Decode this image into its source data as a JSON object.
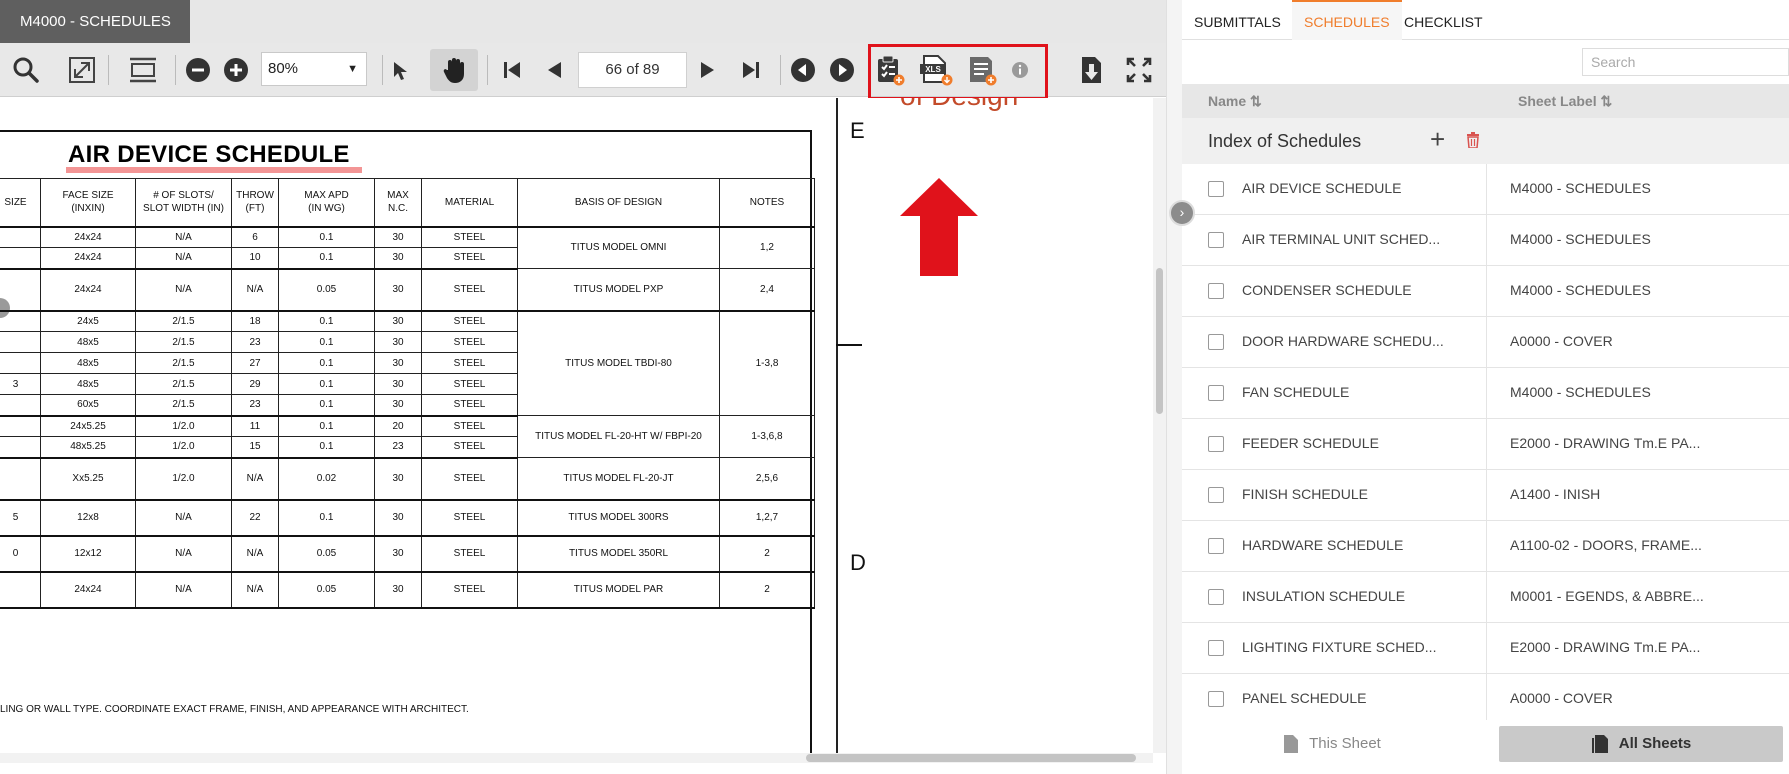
{
  "viewer": {
    "sheet_tab": "M4000 - SCHEDULES",
    "zoom_value": "80%",
    "page_indicator": "66 of 89"
  },
  "drawing": {
    "title": "AIR DEVICE SCHEDULE",
    "headers": [
      "SIZE",
      "FACE SIZE\n(INXIN)",
      "# OF SLOTS/\nSLOT WIDTH (IN)",
      "THROW\n(FT)",
      "MAX APD\n(IN WG)",
      "MAX\nN.C.",
      "MATERIAL",
      "BASIS OF DESIGN",
      "NOTES"
    ],
    "rows": [
      {
        "size": "",
        "face": "24x24",
        "slots": "N/A",
        "throw": "6",
        "apd": "0.1",
        "nc": "30",
        "mat": "STEEL"
      },
      {
        "size": "",
        "face": "24x24",
        "slots": "N/A",
        "throw": "10",
        "apd": "0.1",
        "nc": "30",
        "mat": "STEEL"
      },
      {
        "size": "",
        "face": "24x24",
        "slots": "N/A",
        "throw": "N/A",
        "apd": "0.05",
        "nc": "30",
        "mat": "STEEL"
      },
      {
        "size": "",
        "face": "24x5",
        "slots": "2/1.5",
        "throw": "18",
        "apd": "0.1",
        "nc": "30",
        "mat": "STEEL"
      },
      {
        "size": "",
        "face": "48x5",
        "slots": "2/1.5",
        "throw": "23",
        "apd": "0.1",
        "nc": "30",
        "mat": "STEEL"
      },
      {
        "size": "",
        "face": "48x5",
        "slots": "2/1.5",
        "throw": "27",
        "apd": "0.1",
        "nc": "30",
        "mat": "STEEL"
      },
      {
        "size": "3",
        "face": "48x5",
        "slots": "2/1.5",
        "throw": "29",
        "apd": "0.1",
        "nc": "30",
        "mat": "STEEL"
      },
      {
        "size": "",
        "face": "60x5",
        "slots": "2/1.5",
        "throw": "23",
        "apd": "0.1",
        "nc": "30",
        "mat": "STEEL"
      },
      {
        "size": "",
        "face": "24x5.25",
        "slots": "1/2.0",
        "throw": "11",
        "apd": "0.1",
        "nc": "20",
        "mat": "STEEL"
      },
      {
        "size": "",
        "face": "48x5.25",
        "slots": "1/2.0",
        "throw": "15",
        "apd": "0.1",
        "nc": "23",
        "mat": "STEEL"
      },
      {
        "size": "",
        "face": "Xx5.25",
        "slots": "1/2.0",
        "throw": "N/A",
        "apd": "0.02",
        "nc": "30",
        "mat": "STEEL"
      },
      {
        "size": "5",
        "face": "12x8",
        "slots": "N/A",
        "throw": "22",
        "apd": "0.1",
        "nc": "30",
        "mat": "STEEL"
      },
      {
        "size": "0",
        "face": "12x12",
        "slots": "N/A",
        "throw": "N/A",
        "apd": "0.05",
        "nc": "30",
        "mat": "STEEL"
      },
      {
        "size": "",
        "face": "24x24",
        "slots": "N/A",
        "throw": "N/A",
        "apd": "0.05",
        "nc": "30",
        "mat": "STEEL"
      }
    ],
    "basis": [
      "TITUS MODEL OMNI",
      "TITUS MODEL PXP",
      "TITUS MODEL TBDI-80",
      "TITUS MODEL FL-20-HT W/ FBPI-20",
      "TITUS MODEL FL-20-JT",
      "TITUS MODEL 300RS",
      "TITUS MODEL 350RL",
      "TITUS MODEL PAR"
    ],
    "notes": [
      "1,2",
      "2,4",
      "1-3,8",
      "1-3,6,8",
      "2,5,6",
      "1,2,7",
      "2",
      "2"
    ],
    "zone_e": "E",
    "zone_d": "D",
    "bod_text": "of Design",
    "footnote": "LING OR WALL TYPE. COORDINATE EXACT FRAME, FINISH, AND APPEARANCE WITH ARCHITECT."
  },
  "panel": {
    "tabs": [
      "SUBMITTALS",
      "SCHEDULES",
      "CHECKLIST"
    ],
    "active_tab": "SCHEDULES",
    "search_placeholder": "Search",
    "col_name": "Name ⇅",
    "col_label": "Sheet Label ⇅",
    "group_title": "Index of Schedules",
    "items": [
      {
        "name": "AIR DEVICE SCHEDULE",
        "label": "M4000 - SCHEDULES"
      },
      {
        "name": "AIR TERMINAL UNIT SCHED...",
        "label": "M4000 - SCHEDULES"
      },
      {
        "name": "CONDENSER SCHEDULE",
        "label": "M4000 - SCHEDULES"
      },
      {
        "name": "DOOR HARDWARE SCHEDU...",
        "label": "A0000 - COVER"
      },
      {
        "name": "FAN SCHEDULE",
        "label": "M4000 - SCHEDULES"
      },
      {
        "name": "FEEDER SCHEDULE",
        "label": "E2000 - DRAWING Tm.E PA..."
      },
      {
        "name": "FINISH SCHEDULE",
        "label": "A1400 - INISH"
      },
      {
        "name": "HARDWARE SCHEDULE",
        "label": "A1100-02 - DOORS, FRAME..."
      },
      {
        "name": "INSULATION SCHEDULE",
        "label": "M0001 - EGENDS, & ABBRE..."
      },
      {
        "name": "LIGHTING FIXTURE SCHED...",
        "label": "E2000 - DRAWING Tm.E PA..."
      },
      {
        "name": "PANEL SCHEDULE",
        "label": "A0000 - COVER"
      }
    ],
    "this_sheet": "This Sheet",
    "all_sheets": "All Sheets"
  },
  "colors": {
    "accent": "#f07d2c",
    "highlight": "#e0121b",
    "delete_icon": "#d9534f"
  },
  "icons": [
    "search-icon",
    "fit-page-icon",
    "fit-width-icon",
    "zoom-out-icon",
    "zoom-in-icon",
    "select-arrow-icon",
    "hand-pan-icon",
    "first-page-icon",
    "prev-page-icon",
    "next-page-icon",
    "last-page-icon",
    "back-icon",
    "forward-icon",
    "add-checklist-icon",
    "export-xls-icon",
    "add-schedule-icon",
    "info-icon",
    "download-icon",
    "fullscreen-icon"
  ]
}
